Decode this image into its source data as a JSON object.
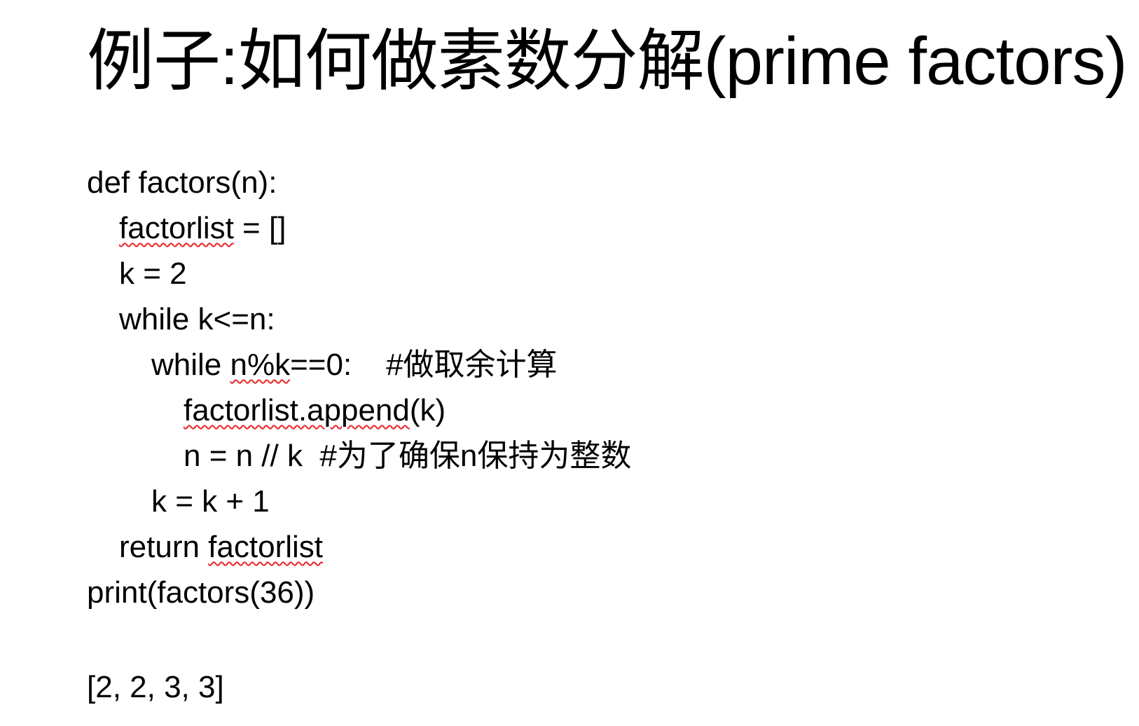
{
  "slide": {
    "title": "例子:如何做素数分解(prime factors)",
    "code": {
      "line1": "def factors(n):",
      "line2_ident": "factorlist",
      "line2_rest": " = []",
      "line3": "k = 2",
      "line4": "while k<=n:",
      "line5_pre": "while ",
      "line5_expr": "n%k",
      "line5_rest": "==0:    #做取余计算",
      "line6_call": "factorlist.append",
      "line6_rest": "(k)",
      "line7": "n = n // k  #为了确保n保持为整数",
      "line8": "k = k + 1",
      "line9_pre": "return ",
      "line9_ident": "factorlist",
      "line10": "print(factors(36))"
    },
    "output": "[2, 2, 3, 3]",
    "spellcheck_color": "#e8262c"
  }
}
